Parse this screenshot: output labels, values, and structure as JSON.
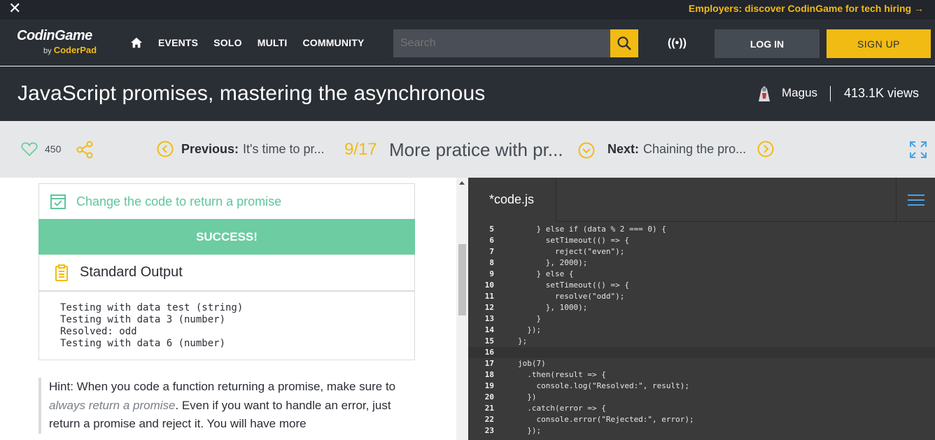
{
  "promo": {
    "close": "✕",
    "message": "Employers: discover CodinGame for tech hiring →"
  },
  "header": {
    "logo_main": "CodinGame",
    "logo_sub_by": "by",
    "logo_sub_brand": "CoderPad",
    "nav": [
      "EVENTS",
      "SOLO",
      "MULTI",
      "COMMUNITY"
    ],
    "search_placeholder": "Search",
    "broadcast": "((•))",
    "login": "LOG IN",
    "signup": "SIGN UP"
  },
  "title": {
    "text": "JavaScript promises, mastering the asynchronous",
    "author": "Magus",
    "views": "413.1K views"
  },
  "strip": {
    "likes": "450",
    "prev_label": "Previous:",
    "prev_title": "It's time to pr...",
    "counter": "9/17",
    "step_title": "More pratice with pr...",
    "next_label": "Next:",
    "next_title": "Chaining the pro..."
  },
  "left": {
    "task": "Change the code to return a promise",
    "success": "SUCCESS!",
    "stdout_title": "Standard Output",
    "stdout_lines": "Testing with data test (string)\nTesting with data 3 (number)\nResolved: odd\nTesting with data 6 (number)",
    "hint_a": "Hint: When you code a function returning a promise, make sure to ",
    "hint_em": "always return a promise",
    "hint_b": ". Even if you want to handle an error, just return a promise and reject it. You will have more"
  },
  "editor": {
    "tab": "*code.js",
    "lines": [
      {
        "n": "5",
        "code": "    } else if (data % 2 === 0) {"
      },
      {
        "n": "6",
        "code": "      setTimeout(() => {"
      },
      {
        "n": "7",
        "code": "        reject(\"even\");"
      },
      {
        "n": "8",
        "code": "      }, 2000);"
      },
      {
        "n": "9",
        "code": "    } else {"
      },
      {
        "n": "10",
        "code": "      setTimeout(() => {"
      },
      {
        "n": "11",
        "code": "        resolve(\"odd\");"
      },
      {
        "n": "12",
        "code": "      }, 1000);"
      },
      {
        "n": "13",
        "code": "    }"
      },
      {
        "n": "14",
        "code": "  });"
      },
      {
        "n": "15",
        "code": "};"
      },
      {
        "n": "16",
        "code": ""
      },
      {
        "n": "17",
        "code": "job(7)"
      },
      {
        "n": "18",
        "code": "  .then(result => {"
      },
      {
        "n": "19",
        "code": "    console.log(\"Resolved:\", result);"
      },
      {
        "n": "20",
        "code": "  })"
      },
      {
        "n": "21",
        "code": "  .catch(error => {"
      },
      {
        "n": "22",
        "code": "    console.error(\"Rejected:\", error);"
      },
      {
        "n": "23",
        "code": "  });"
      }
    ],
    "active_line": "16"
  },
  "colors": {
    "accent": "#f2bb13",
    "success": "#6dcca1",
    "dark": "#2a2e35"
  }
}
